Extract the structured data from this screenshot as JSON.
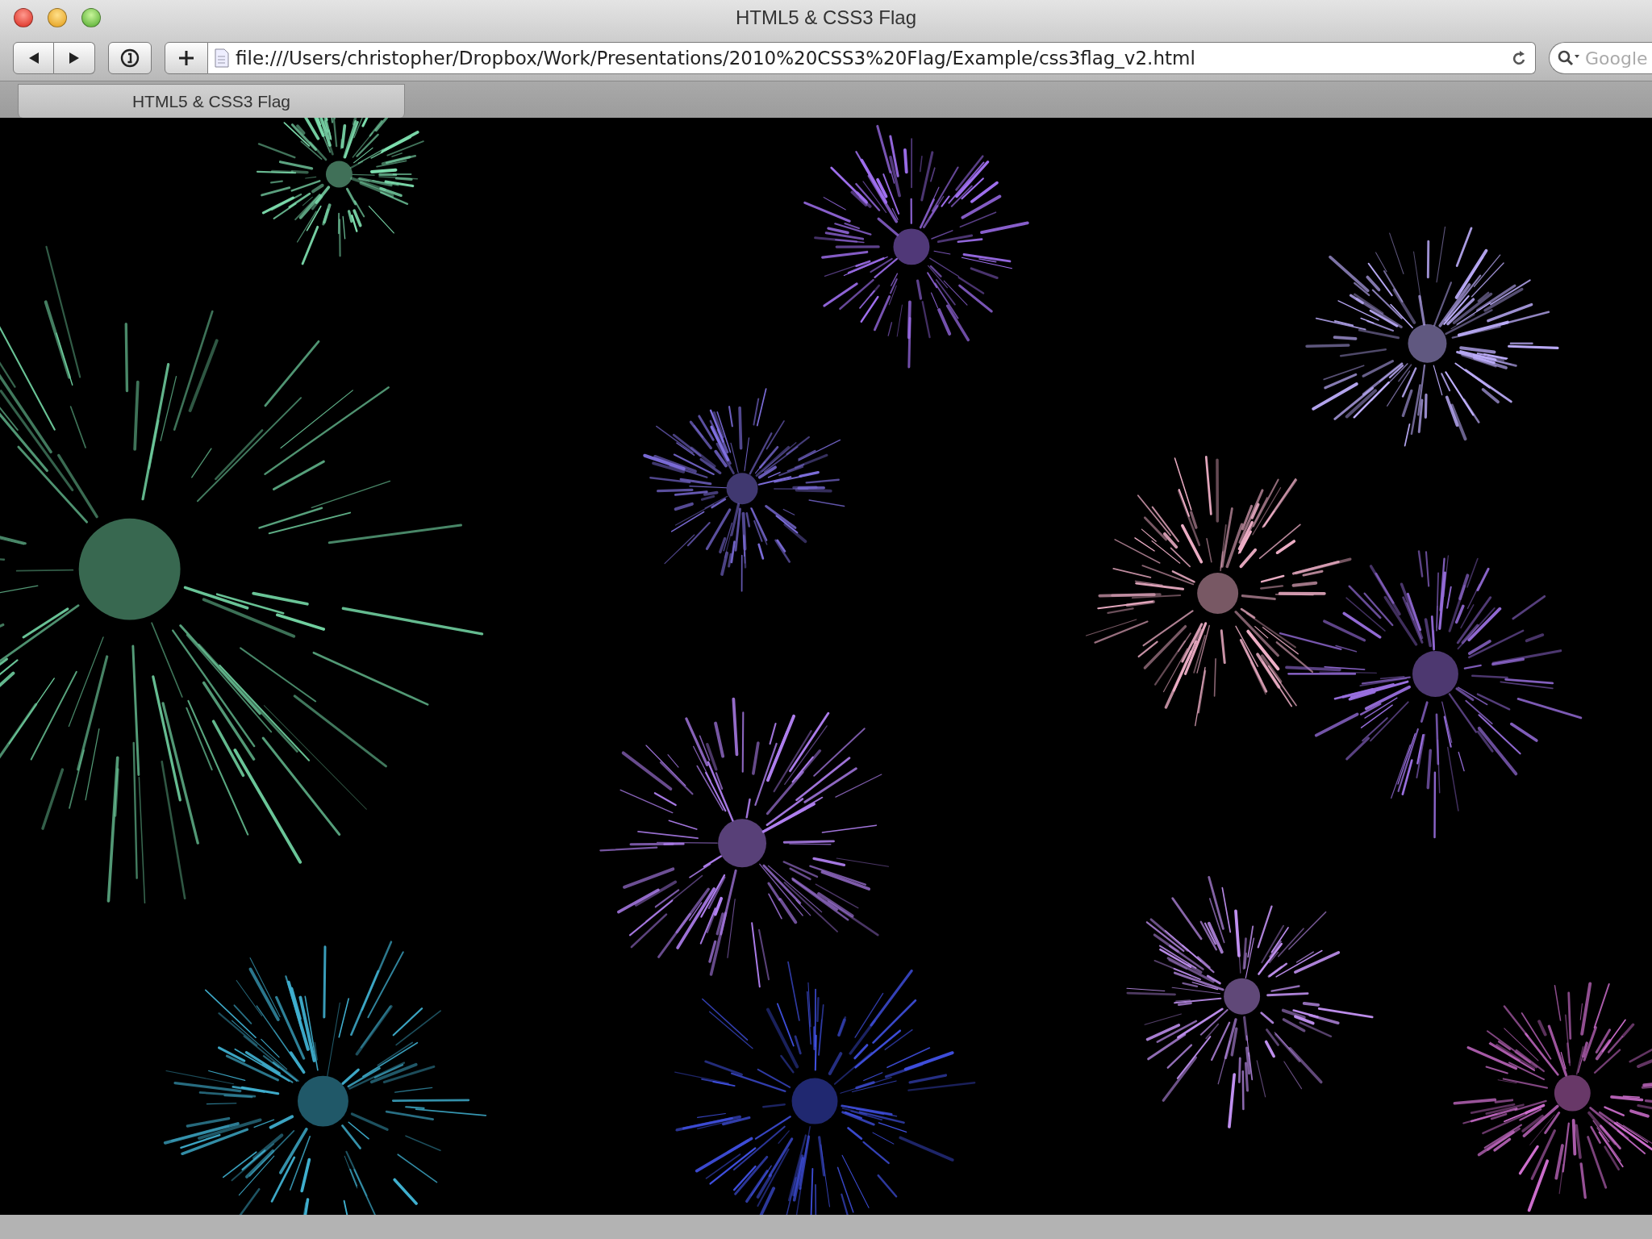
{
  "window": {
    "title": "HTML5 & CSS3 Flag"
  },
  "toolbar": {
    "url": "file:///Users/christopher/Dropbox/Work/Presentations/2010%20CSS3%20Flag/Example/css3flag_v2.html",
    "search": {
      "placeholder": "Google"
    }
  },
  "tabs": [
    {
      "label": "HTML5 & CSS3 Flag",
      "selected": true
    }
  ]
}
